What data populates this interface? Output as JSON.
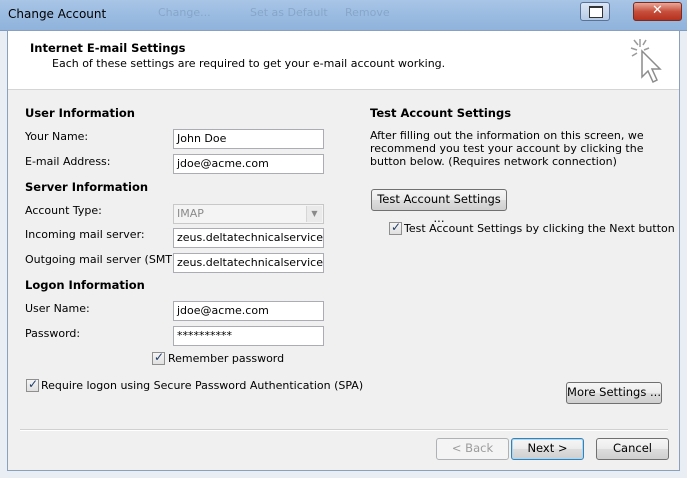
{
  "window": {
    "title": "Change Account",
    "ghost_items": [
      "Change...",
      "Set as Default",
      "Remove"
    ]
  },
  "header": {
    "title": "Internet E-mail Settings",
    "subtitle": "Each of these settings are required to get your e-mail account working."
  },
  "user_info": {
    "heading": "User Information",
    "name_label": "Your Name:",
    "name_value": "John Doe",
    "email_label": "E-mail Address:",
    "email_value": "jdoe@acme.com"
  },
  "server_info": {
    "heading": "Server Information",
    "account_type_label": "Account Type:",
    "account_type_value": "IMAP",
    "incoming_label": "Incoming mail server:",
    "incoming_value": "zeus.deltatechnicalservices.co",
    "outgoing_label": "Outgoing mail server (SMTP):",
    "outgoing_value": "zeus.deltatechnicalservices.co"
  },
  "logon_info": {
    "heading": "Logon Information",
    "username_label": "User Name:",
    "username_value": "jdoe@acme.com",
    "password_label": "Password:",
    "password_value": "**********",
    "remember_label": "Remember password",
    "remember_checked": true,
    "spa_label": "Require logon using Secure Password Authentication (SPA)",
    "spa_checked": true
  },
  "test_settings": {
    "heading": "Test Account Settings",
    "description": "After filling out the information on this screen, we recommend you test your account by clicking the button below. (Requires network connection)",
    "button_label": "Test Account Settings ...",
    "next_check_label": "Test Account Settings by clicking the Next button",
    "next_check_checked": true
  },
  "buttons": {
    "more_settings": "More Settings ...",
    "back": "< Back",
    "next": "Next >",
    "cancel": "Cancel"
  }
}
